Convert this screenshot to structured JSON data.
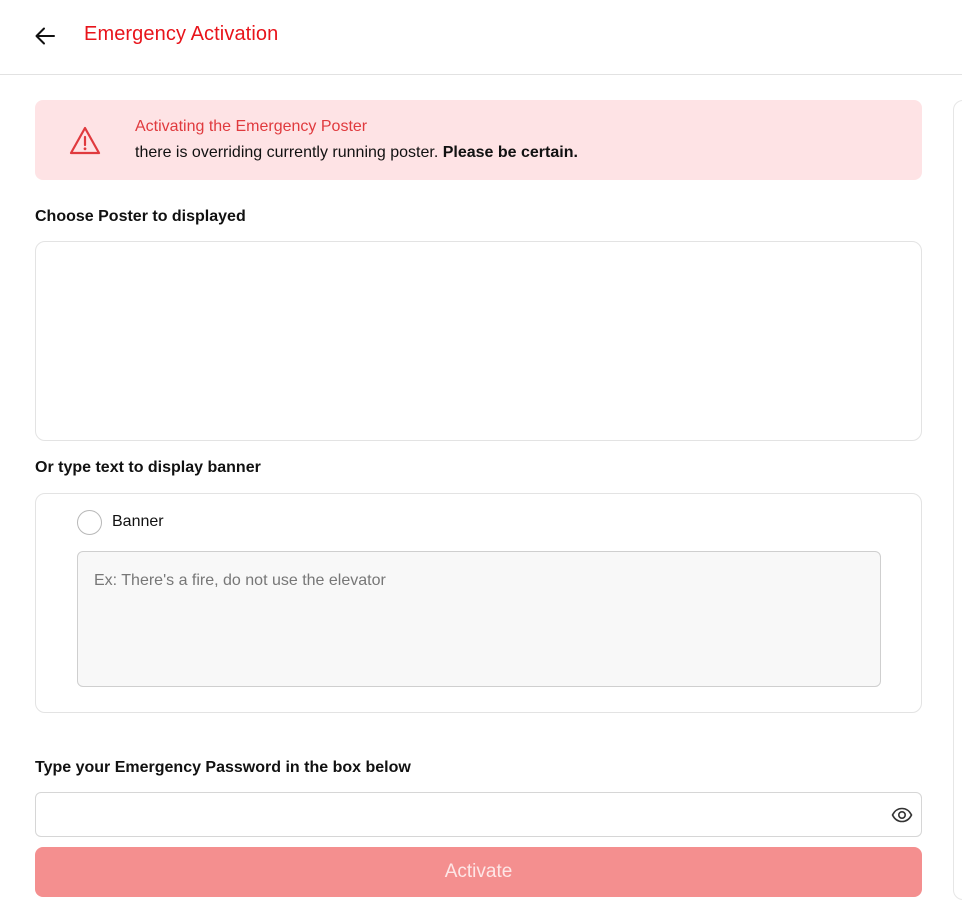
{
  "header": {
    "title": "Emergency Activation",
    "back_icon": "arrow-left-icon",
    "title_color": "#e8141b"
  },
  "alert": {
    "icon": "warning-triangle-icon",
    "title": "Activating the Emergency Poster",
    "body_text": "there is overriding currently running poster.",
    "body_emphasis": "Please be certain.",
    "background_color": "#fee3e5",
    "accent_color": "#e03a3e"
  },
  "poster_section": {
    "label": "Choose Poster to displayed"
  },
  "banner_section": {
    "label": "Or type text to display banner",
    "radio_label": "Banner",
    "radio_checked": false,
    "textarea_placeholder": "Ex: There's a fire, do not use the elevator",
    "textarea_value": ""
  },
  "password_section": {
    "label": "Type your Emergency Password in the box below",
    "value": "",
    "eye_icon": "eye-icon"
  },
  "activate_button": {
    "label": "Activate",
    "color": "#f48f8f",
    "disabled": true
  }
}
